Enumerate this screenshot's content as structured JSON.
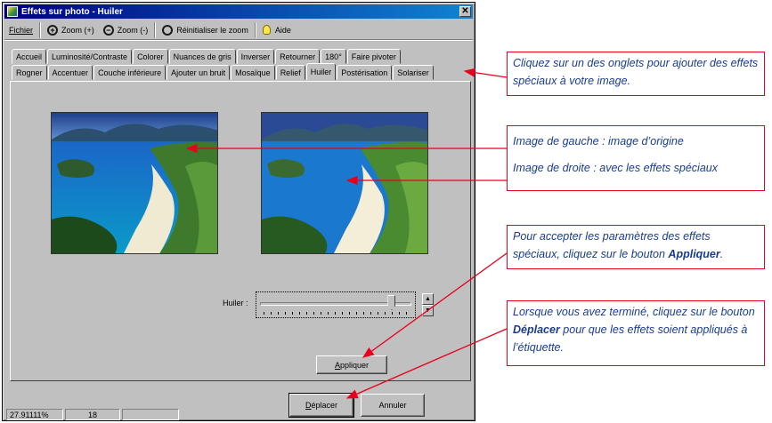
{
  "window": {
    "title": "Effets sur photo - Huiler",
    "close_glyph": "✕"
  },
  "menu": {
    "file": "Fichier",
    "zoom_in": "Zoom (+)",
    "zoom_out": "Zoom (-)",
    "reset_zoom": "Réinitialiser le zoom",
    "help": "Aide"
  },
  "tabs_row1": [
    "Accueil",
    "Luminosité/Contraste",
    "Colorer",
    "Nuances de gris",
    "Inverser",
    "Retourner",
    "180°",
    "Faire pivoter"
  ],
  "tabs_row2": [
    "Rogner",
    "Accentuer",
    "Couche inférieure",
    "Ajouter un bruit",
    "Mosaïque",
    "Relief",
    "Huiler",
    "Postérisation",
    "Solariser"
  ],
  "active_tab": "Huiler",
  "slider": {
    "label": "Huiler :",
    "value_fraction": 0.88
  },
  "buttons": {
    "apply": "Appliquer",
    "move": "Déplacer",
    "cancel": "Annuler"
  },
  "status": {
    "zoom": "27.91111%",
    "value": "18",
    "empty": ""
  },
  "annotations": {
    "tabs": "Cliquez sur un des onglets pour ajouter des effets spéciaux à votre image.",
    "left_image": "Image de gauche : image d’origine",
    "right_image": "Image de droite : avec les effets spéciaux",
    "apply_pre": "Pour accepter les paramètres des effets spéciaux, cliquez sur le bouton ",
    "apply_bold": "Appliquer",
    "apply_post": ".",
    "move_pre": "Lorsque vous avez terminé, cliquez sur le bouton ",
    "move_bold": "Déplacer",
    "move_post": " pour que les effets soient appliqués à l’étiquette."
  },
  "colors": {
    "title_bar": "#000080",
    "annotation_text": "#1a3c8f",
    "annotation_line": "#e8001c",
    "dialog": "#c0c0c0"
  },
  "icons": [
    "app-icon",
    "zoom-in-icon",
    "zoom-out-icon",
    "search-icon",
    "help-bulb-icon",
    "close-icon"
  ]
}
